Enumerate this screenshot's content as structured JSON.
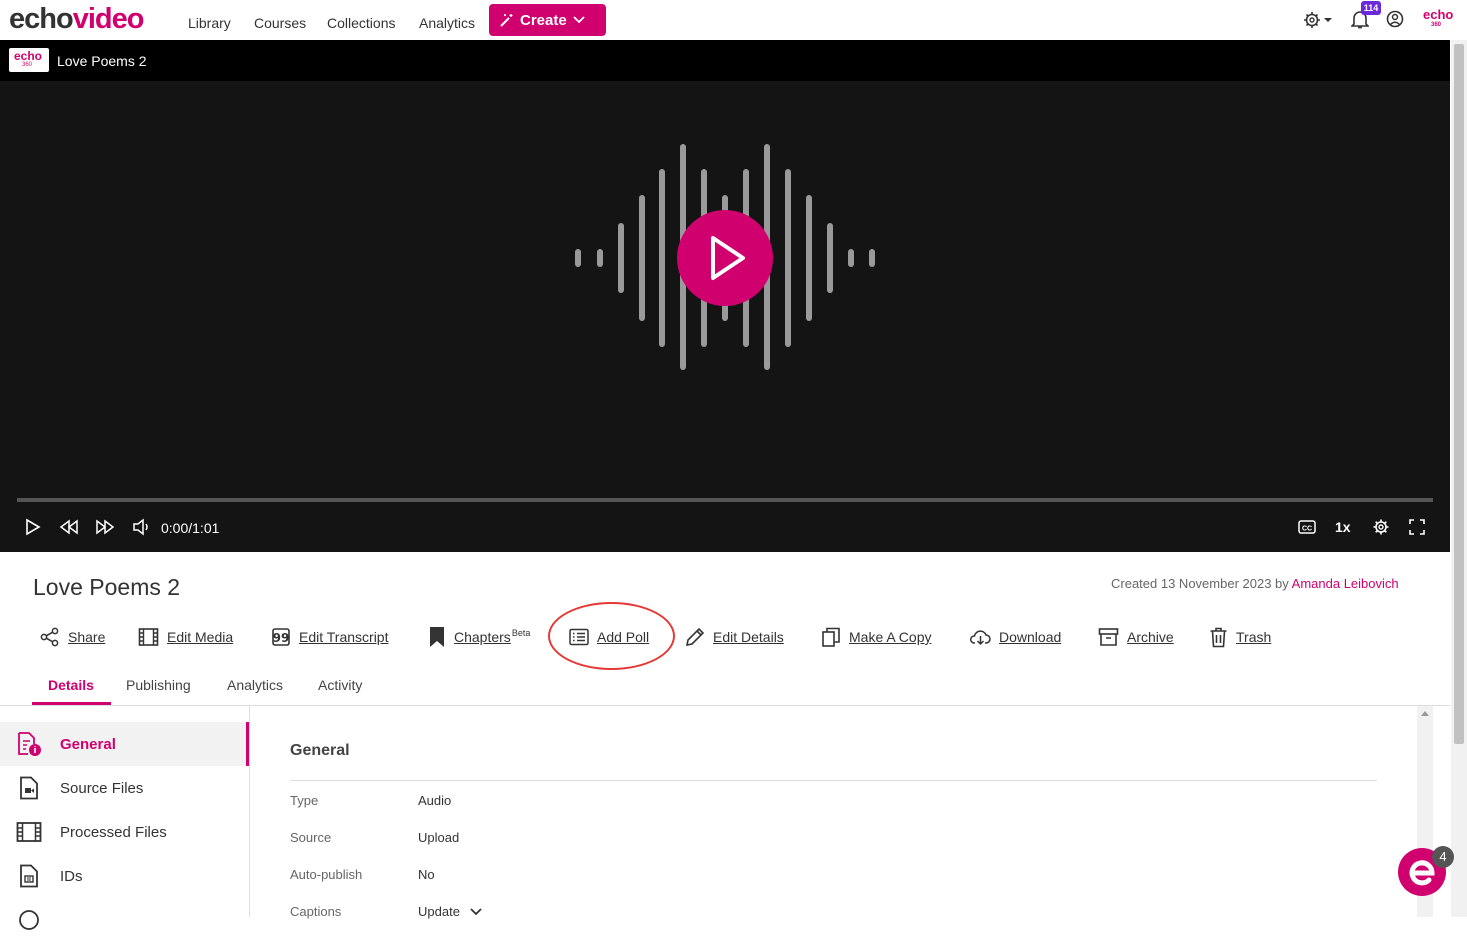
{
  "brand": {
    "part1": "echo",
    "part2": "video"
  },
  "nav": [
    "Library",
    "Courses",
    "Collections",
    "Analytics"
  ],
  "create_label": "Create",
  "notifications_count": "114",
  "small_logo": {
    "word": "echo",
    "number": "360"
  },
  "player": {
    "logo_word": "echo",
    "logo_number": "360",
    "title": "Love Poems 2",
    "time": "0:00/1:01",
    "speed": "1x",
    "progress": 0
  },
  "media": {
    "title": "Love Poems 2",
    "created_prefix": "Created 13 November 2023 by ",
    "author": "Amanda Leibovich"
  },
  "actions": [
    {
      "name": "share",
      "label": "Share",
      "icon": "share-icon"
    },
    {
      "name": "edit-media",
      "label": "Edit Media",
      "icon": "film-icon"
    },
    {
      "name": "edit-transcript",
      "label": "Edit Transcript",
      "icon": "quote-icon"
    },
    {
      "name": "chapters",
      "label": "Chapters",
      "sup": "Beta",
      "icon": "bookmark-icon"
    },
    {
      "name": "add-poll",
      "label": "Add Poll",
      "icon": "list-icon"
    },
    {
      "name": "edit-details",
      "label": "Edit Details",
      "icon": "pencil-icon"
    },
    {
      "name": "make-copy",
      "label": "Make A Copy",
      "icon": "copy-icon"
    },
    {
      "name": "download",
      "label": "Download",
      "icon": "cloud-download-icon"
    },
    {
      "name": "archive",
      "label": "Archive",
      "icon": "archive-icon"
    },
    {
      "name": "trash",
      "label": "Trash",
      "icon": "trash-icon"
    }
  ],
  "tabs": [
    "Details",
    "Publishing",
    "Analytics",
    "Activity"
  ],
  "side_menu": [
    "General",
    "Source Files",
    "Processed Files",
    "IDs"
  ],
  "general": {
    "title": "General",
    "rows": [
      {
        "label": "Type",
        "value": "Audio"
      },
      {
        "label": "Source",
        "value": "Upload"
      },
      {
        "label": "Auto-publish",
        "value": "No"
      },
      {
        "label": "Captions",
        "value": "Update"
      }
    ]
  },
  "chat_badge": "4",
  "colors": {
    "accent": "#d0006f",
    "highlight": "#e53935",
    "badge": "#6d28d9"
  }
}
